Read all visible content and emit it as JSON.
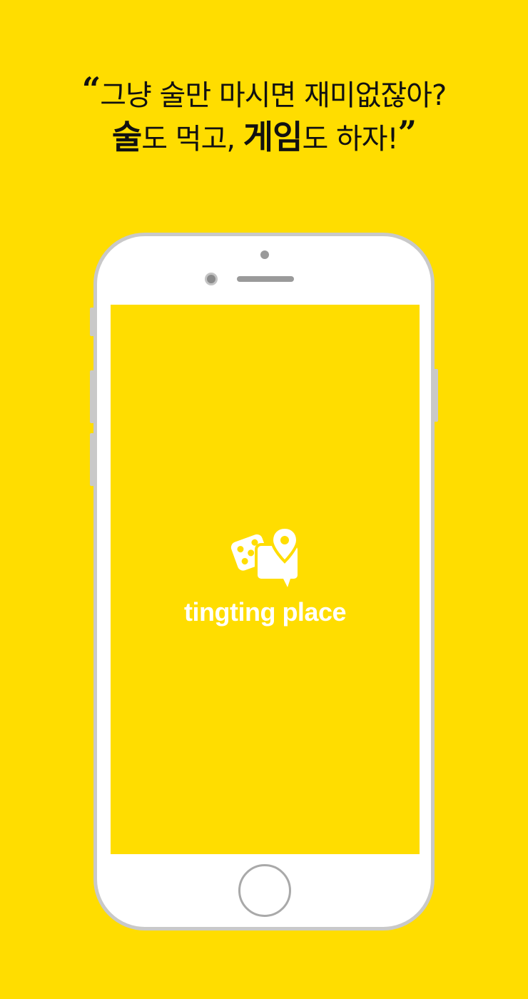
{
  "headline": {
    "open_quote": "“",
    "line1": "그냥 술만 마시면 재미없잖아?",
    "line2_part1": "술",
    "line2_part2": "도 먹고, ",
    "line2_part3": "게임",
    "line2_part4": "도 하자!",
    "close_quote": "”"
  },
  "app": {
    "brand_name": "tingting place",
    "logo_icon": "dice-chat-location-icon"
  },
  "colors": {
    "background": "#FFDD00",
    "screen": "#FFDD00",
    "phone_frame": "#c9c9c9",
    "text": "#111111",
    "brand_text": "#ffffff"
  }
}
